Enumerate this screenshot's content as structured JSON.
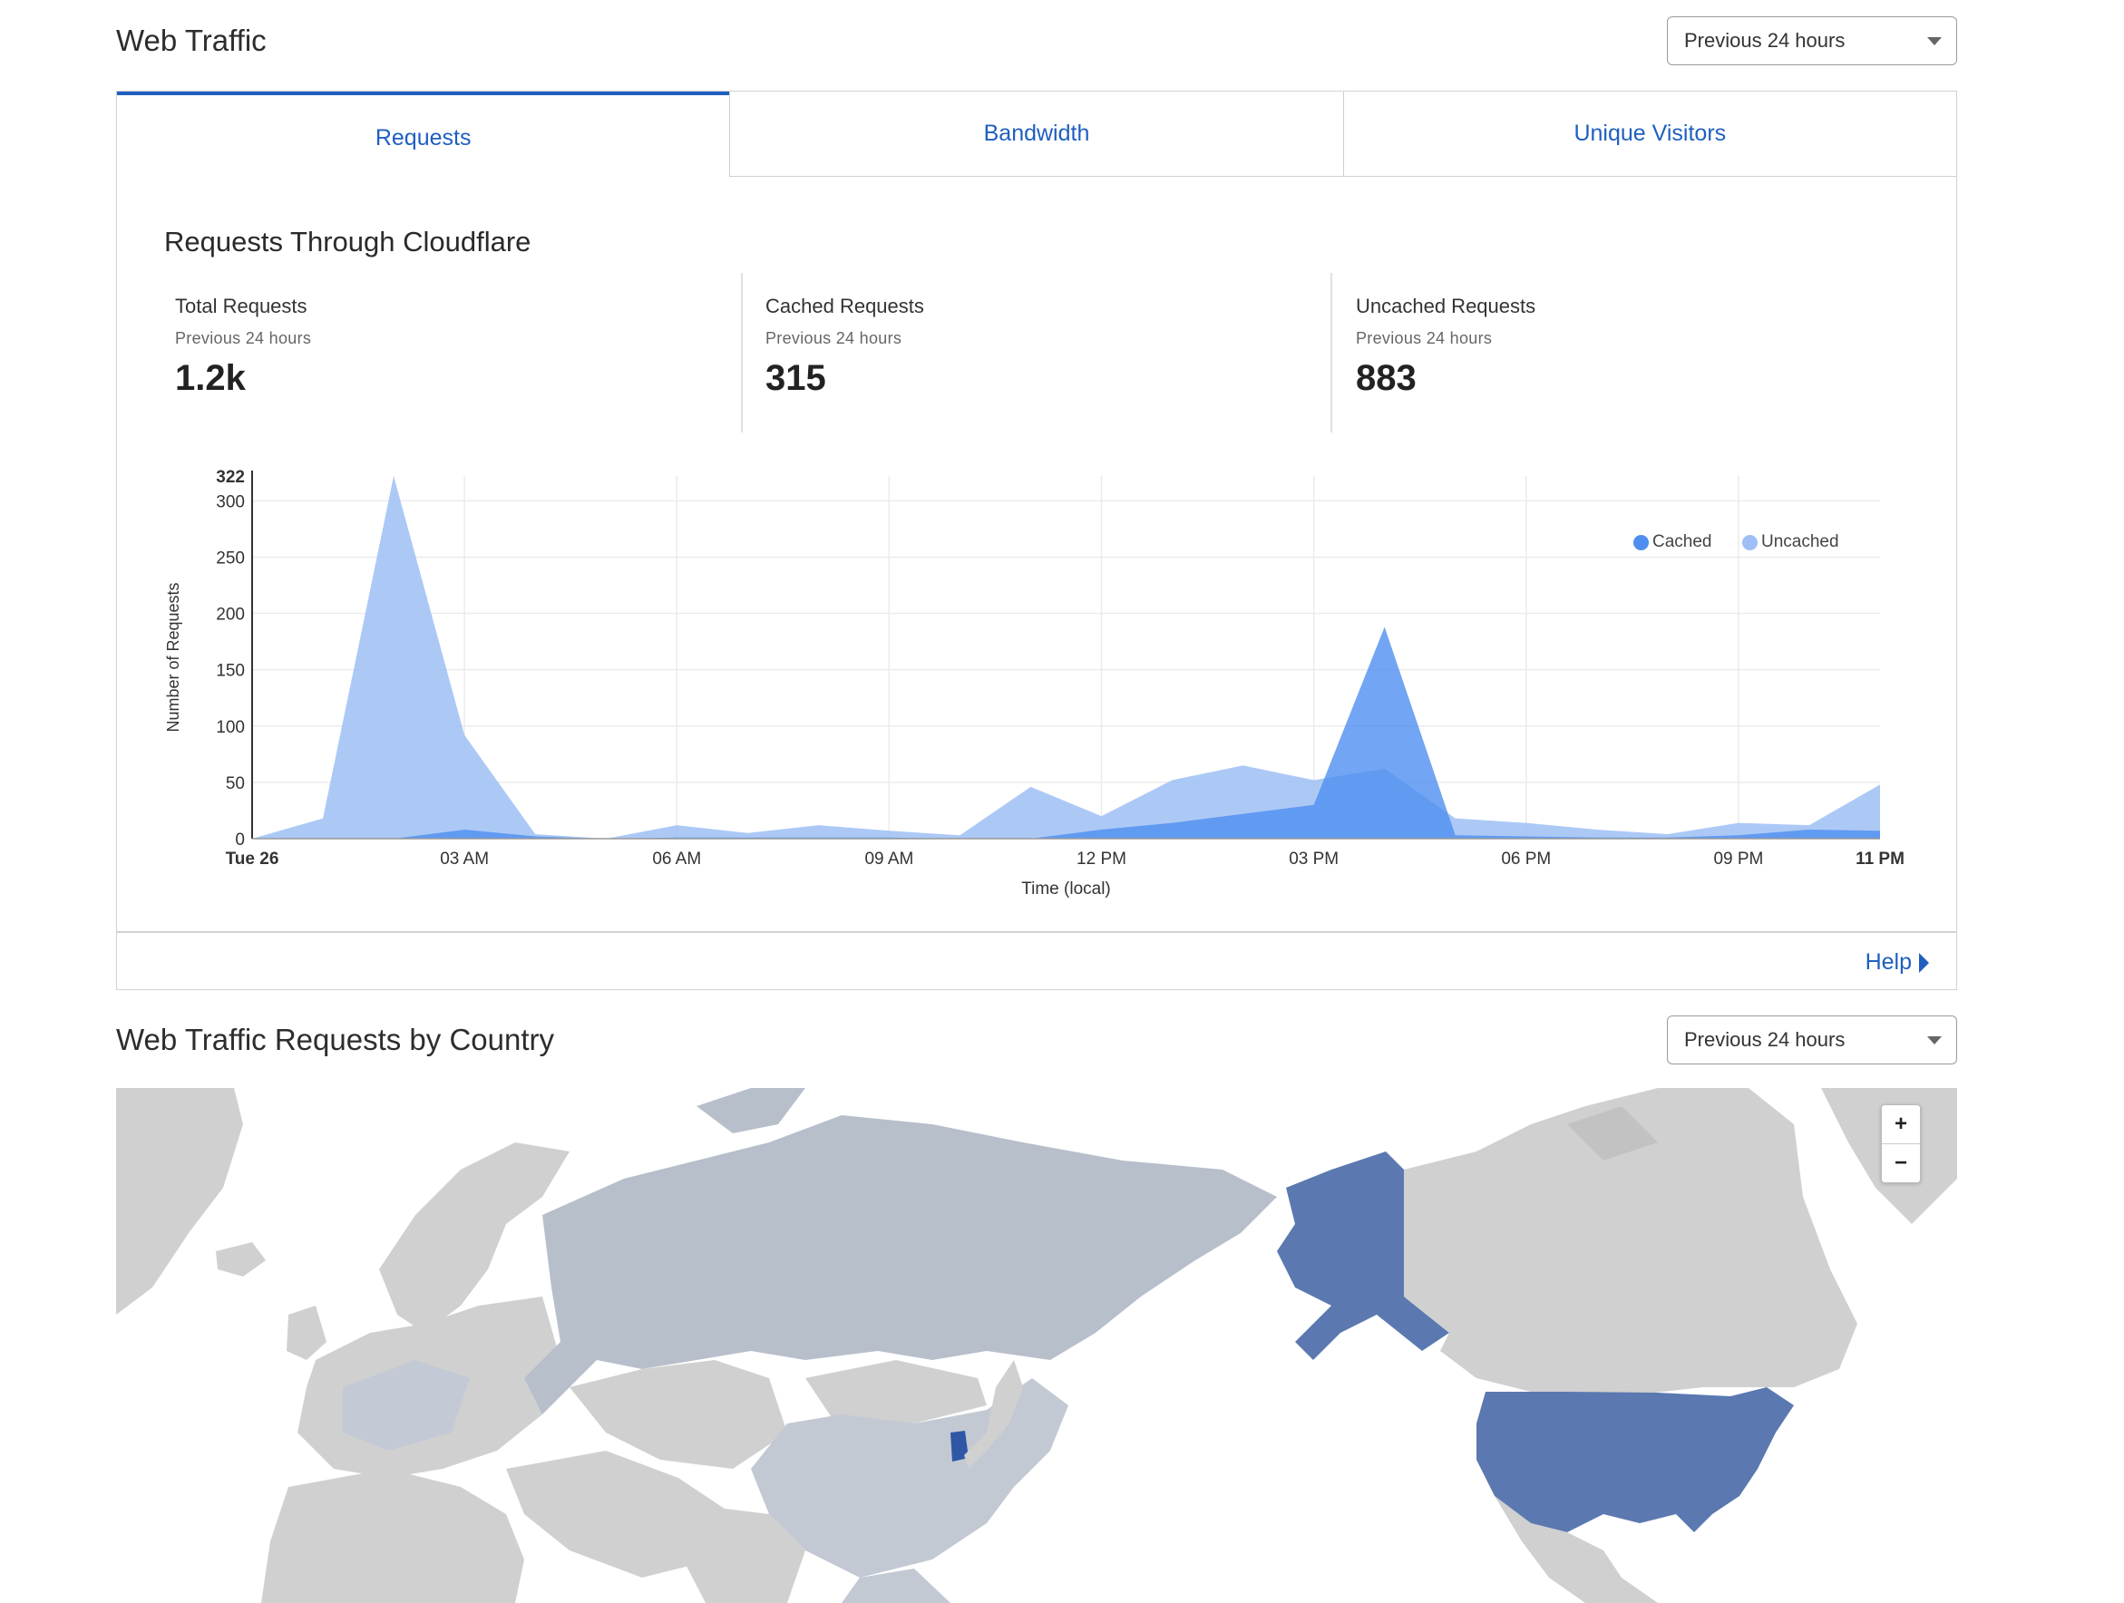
{
  "web_traffic": {
    "title": "Web Traffic",
    "period_select": "Previous 24 hours",
    "tabs": [
      {
        "label": "Requests",
        "active": true
      },
      {
        "label": "Bandwidth",
        "active": false
      },
      {
        "label": "Unique Visitors",
        "active": false
      }
    ],
    "panel_title": "Requests Through Cloudflare",
    "stats": [
      {
        "label": "Total Requests",
        "sub": "Previous 24 hours",
        "value": "1.2k"
      },
      {
        "label": "Cached Requests",
        "sub": "Previous 24 hours",
        "value": "315"
      },
      {
        "label": "Uncached Requests",
        "sub": "Previous 24 hours",
        "value": "883"
      }
    ],
    "help_label": "Help"
  },
  "chart_data": {
    "type": "area",
    "title": "",
    "xlabel": "Time (local)",
    "ylabel": "Number of Requests",
    "ylim": [
      0,
      322
    ],
    "yticks": [
      "0",
      "50",
      "100",
      "150",
      "200",
      "250",
      "300",
      "322"
    ],
    "xticks": [
      "Tue 26",
      "03 AM",
      "06 AM",
      "09 AM",
      "12 PM",
      "03 PM",
      "06 PM",
      "09 PM",
      "11 PM"
    ],
    "x_hours": [
      0,
      1,
      2,
      3,
      4,
      5,
      6,
      7,
      8,
      9,
      10,
      11,
      12,
      13,
      14,
      15,
      16,
      17,
      18,
      19,
      20,
      21,
      22,
      23
    ],
    "legend_position": "top-right",
    "grid": true,
    "series": [
      {
        "name": "Cached",
        "color": "#4f8ef0",
        "values": [
          0,
          0,
          0,
          8,
          2,
          0,
          1,
          1,
          1,
          1,
          0,
          0,
          8,
          14,
          22,
          30,
          188,
          3,
          2,
          1,
          1,
          3,
          8,
          7
        ]
      },
      {
        "name": "Uncached",
        "color": "#9ebff5",
        "values": [
          0,
          18,
          322,
          92,
          4,
          0,
          12,
          5,
          12,
          7,
          3,
          46,
          20,
          52,
          65,
          52,
          62,
          18,
          14,
          8,
          4,
          14,
          12,
          48
        ]
      }
    ]
  },
  "country_map": {
    "title": "Web Traffic Requests by Country",
    "period_select": "Previous 24 hours",
    "zoom_in": "+",
    "zoom_out": "−"
  }
}
